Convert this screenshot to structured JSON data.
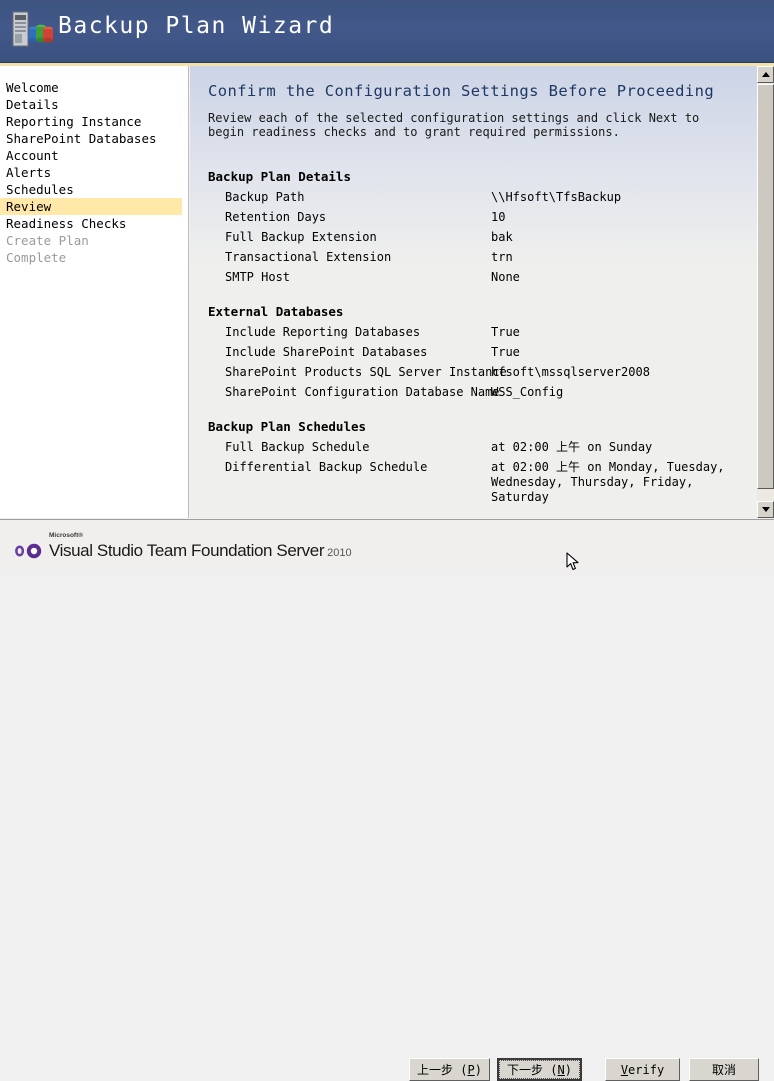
{
  "window": {
    "title": "Backup Plan Wizard",
    "icon": "server-database-icon"
  },
  "sidebar": {
    "items": [
      {
        "label": "Welcome",
        "state": "done"
      },
      {
        "label": "Details",
        "state": "done"
      },
      {
        "label": "Reporting Instance",
        "state": "done"
      },
      {
        "label": "SharePoint Databases",
        "state": "done"
      },
      {
        "label": "Account",
        "state": "done"
      },
      {
        "label": "Alerts",
        "state": "done"
      },
      {
        "label": "Schedules",
        "state": "done"
      },
      {
        "label": "Review",
        "state": "active"
      },
      {
        "label": "Readiness Checks",
        "state": "done"
      },
      {
        "label": "Create Plan",
        "state": "disabled"
      },
      {
        "label": "Complete",
        "state": "disabled"
      }
    ]
  },
  "main": {
    "heading": "Confirm the Configuration Settings Before Proceeding",
    "description": "Review each of the selected configuration settings and click Next to begin readiness checks and to grant required permissions.",
    "sections": [
      {
        "title": "Backup Plan Details",
        "rows": [
          {
            "label": "Backup Path",
            "value": "\\\\Hfsoft\\TfsBackup"
          },
          {
            "label": "Retention Days",
            "value": "10"
          },
          {
            "label": "Full Backup Extension",
            "value": "bak"
          },
          {
            "label": "Transactional Extension",
            "value": "trn"
          },
          {
            "label": "SMTP Host",
            "value": "None"
          }
        ]
      },
      {
        "title": "External Databases",
        "rows": [
          {
            "label": "Include Reporting Databases",
            "value": "True"
          },
          {
            "label": "Include SharePoint Databases",
            "value": "True"
          },
          {
            "label": "SharePoint Products SQL Server Instance",
            "value": "hfsoft\\mssqlserver2008"
          },
          {
            "label": "SharePoint Configuration Database Name",
            "value": "WSS_Config"
          }
        ]
      },
      {
        "title": "Backup Plan Schedules",
        "rows": [
          {
            "label": "Full Backup Schedule",
            "value": "at 02:00 上午 on  Sunday"
          },
          {
            "label": "Differential Backup Schedule",
            "value": "at 02:00 上午 on  Monday,  Tuesday, Wednesday,  Thursday,  Friday, Saturday"
          }
        ]
      }
    ]
  },
  "scrollbar": {
    "up_arrow": "scroll-up-icon",
    "down_arrow": "scroll-down-icon"
  },
  "footer": {
    "product_microsoft": "Microsoft®",
    "product_name": "Visual Studio Team Foundation Server",
    "product_year": "2010",
    "buttons": {
      "previous": {
        "text_pre": "上一步 (",
        "accel": "P",
        "text_post": ")"
      },
      "next": {
        "text_pre": "下一步 (",
        "accel": "N",
        "text_post": ")"
      },
      "verify": {
        "accel": "V",
        "text_post": "erify"
      },
      "cancel": {
        "label": "取消"
      }
    }
  },
  "colors": {
    "header_blue": "#42588a",
    "header_rule_gold": "#f5e2a8",
    "active_nav": "#ffe8a8",
    "heading_text": "#1f3864"
  }
}
